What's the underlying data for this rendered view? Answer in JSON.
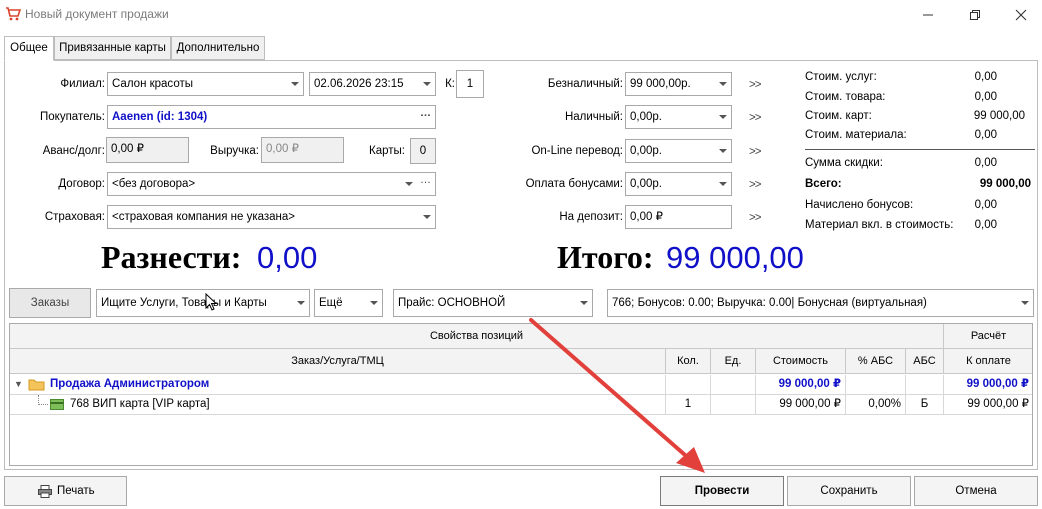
{
  "window": {
    "title": "Новый документ продажи"
  },
  "tabs": [
    "Общее",
    "Привязанные карты",
    "Дополнительно"
  ],
  "form": {
    "branch_label": "Филиал:",
    "branch_value": "Салон красоты",
    "datetime_value": "02.06.2026 23:15",
    "k_label": "К:",
    "k_value": "1",
    "buyer_label": "Покупатель:",
    "buyer_value": "Aaenen  (id: 1304)",
    "advance_label": "Аванс/долг:",
    "advance_value": "0,00 ₽",
    "revenue_label": "Выручка:",
    "revenue_value": "0,00 ₽",
    "cards_label": "Карты:",
    "cards_value": "0",
    "contract_label": "Договор:",
    "contract_value": "<без договора>",
    "insurance_label": "Страховая:",
    "insurance_value": "<страховая компания не указана>"
  },
  "payments": {
    "cashless_label": "Безналичный:",
    "cashless_value": "99 000,00р.",
    "cash_label": "Наличный:",
    "cash_value": "0,00р.",
    "online_label": "On-Line перевод:",
    "online_value": "0,00р.",
    "bonus_label": "Оплата бонусами:",
    "bonus_value": "0,00р.",
    "deposit_label": "На депозит:",
    "deposit_value": "0,00 ₽",
    "arrows": ">>"
  },
  "summary": {
    "services_label": "Стоим. услуг:",
    "services_value": "0,00",
    "goods_label": "Стоим. товара:",
    "goods_value": "0,00",
    "cards_label": "Стоим. карт:",
    "cards_value": "99 000,00",
    "material_label": "Стоим. материала:",
    "material_value": "0,00",
    "discount_label": "Сумма скидки:",
    "discount_value": "0,00",
    "total_label": "Всего:",
    "total_value": "99 000,00",
    "bonus_label": "Начислено бонусов:",
    "bonus_value": "0,00",
    "material_incl_label": "Материал вкл. в стоимость:",
    "material_incl_value": "0,00"
  },
  "big": {
    "distribute_label": "Разнести:",
    "distribute_value": "0,00",
    "total_label": "Итого:",
    "total_value": "99 000,00"
  },
  "toolbar": {
    "orders_label": "Заказы",
    "search_placeholder": "Ищите Услуги, Товары и Карты",
    "more_label": "Ещё",
    "price_value": "Прайс: ОСНОВНОЙ",
    "card_info_value": "766; Бонусов: 0.00; Выручка: 0.00| Бонусная (виртуальная)"
  },
  "grid": {
    "group_header": "Свойства позиций",
    "calc_header": "Расчёт",
    "columns": [
      "Заказ/Услуга/ТМЦ",
      "Кол.",
      "Ед.",
      "Стоимость",
      "% АБС",
      "АБС",
      "К оплате"
    ],
    "group_row": {
      "name": "Продажа Администратором",
      "cost": "99 000,00 ₽",
      "pay": "99 000,00 ₽"
    },
    "item_row": {
      "name": "768 ВИП карта [VIP карта]",
      "qty": "1",
      "unit": "",
      "cost": "99 000,00 ₽",
      "abs_pct": "0,00%",
      "abs": "Б",
      "pay": "99 000,00 ₽"
    }
  },
  "footer": {
    "print_label": "Печать",
    "post_label": "Провести",
    "save_label": "Сохранить",
    "cancel_label": "Отмена"
  },
  "colors": {
    "accent_blue": "#1010c8",
    "annotation_red": "#e2403a"
  }
}
